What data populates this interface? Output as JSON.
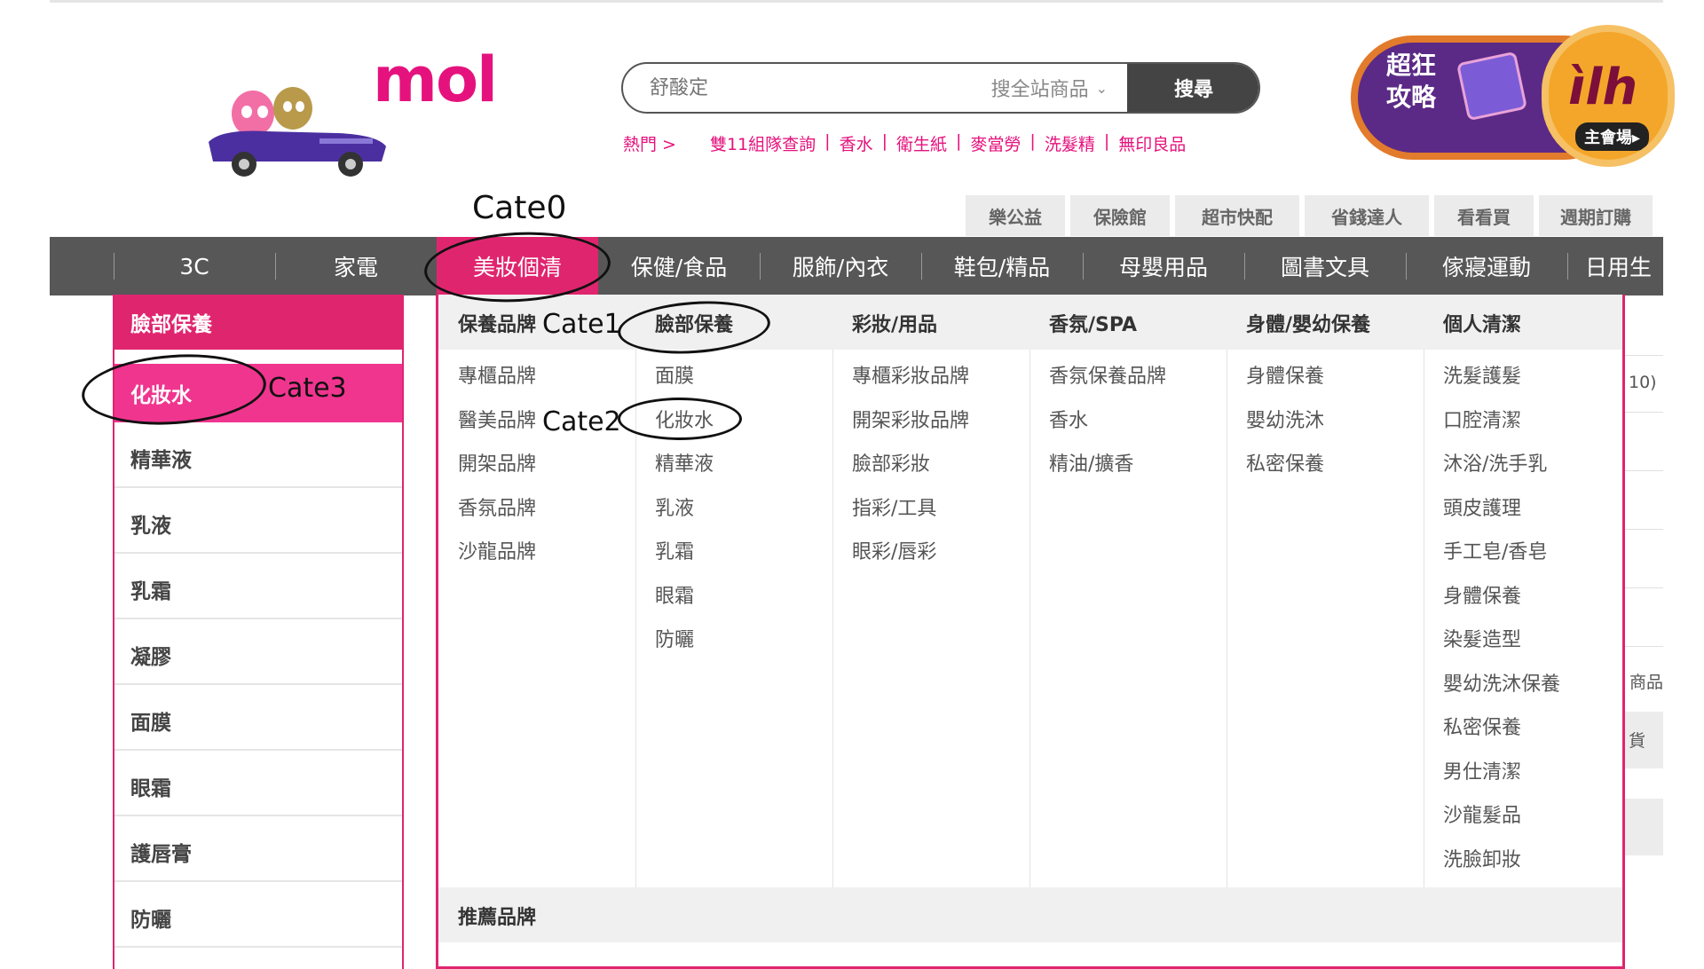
{
  "logo": {
    "text": "mol"
  },
  "search": {
    "placeholder": "舒酸定",
    "scope_label": "搜全站商品",
    "button_label": "搜尋"
  },
  "hot": {
    "label": "熱門 >",
    "keywords": [
      "雙11組隊查詢",
      "香水",
      "衛生紙",
      "麥當勞",
      "洗髮精",
      "無印良品"
    ],
    "separator": "|"
  },
  "promo": {
    "line1": "超狂",
    "line2": "攻略",
    "logo": "ìlh",
    "badge": "主會場▸"
  },
  "top_tabs": [
    "樂公益",
    "保險館",
    "超市快配",
    "省錢達人",
    "看看買",
    "週期訂購"
  ],
  "nav": {
    "items": [
      "3C",
      "家電",
      "美妝個清",
      "保健/食品",
      "服飾/內衣",
      "鞋包/精品",
      "母嬰用品",
      "圖書文具",
      "傢寢運動",
      "日用生"
    ],
    "active": "美妝個清"
  },
  "left_panel": {
    "header": "臉部保養",
    "items": [
      "化妝水",
      "精華液",
      "乳液",
      "乳霜",
      "凝膠",
      "面膜",
      "眼霜",
      "護唇膏",
      "防曬"
    ],
    "active": "化妝水"
  },
  "mega_menu": {
    "columns": [
      {
        "title": "保養品牌",
        "links": [
          "專櫃品牌",
          "醫美品牌",
          "開架品牌",
          "香氛品牌",
          "沙龍品牌"
        ]
      },
      {
        "title": "臉部保養",
        "links": [
          "面膜",
          "化妝水",
          "精華液",
          "乳液",
          "乳霜",
          "眼霜",
          "防曬"
        ]
      },
      {
        "title": "彩妝/用品",
        "links": [
          "專櫃彩妝品牌",
          "開架彩妝品牌",
          "臉部彩妝",
          "指彩/工具",
          "眼彩/唇彩"
        ]
      },
      {
        "title": "香氛/SPA",
        "links": [
          "香氛保養品牌",
          "香水",
          "精油/擴香"
        ]
      },
      {
        "title": "身體/嬰幼保養",
        "links": [
          "身體保養",
          "嬰幼洗沐",
          "私密保養"
        ]
      },
      {
        "title": "個人清潔",
        "links": [
          "洗髮護髮",
          "口腔清潔",
          "沐浴/洗手乳",
          "頭皮護理",
          "手工皂/香皂",
          "身體保養",
          "染髮造型",
          "嬰幼洗沐保養",
          "私密保養",
          "男仕清潔",
          "沙龍髮品",
          "洗臉卸妝"
        ]
      }
    ],
    "recommended_brands": "推薦品牌"
  },
  "annotations": {
    "cate0": "Cate0",
    "cate1": "Cate1",
    "cate2": "Cate2",
    "cate3": "Cate3"
  },
  "right_peek": {
    "text1": "10)",
    "text2": "商品",
    "text3": "貨"
  },
  "colors": {
    "brand": "#e5127d",
    "nav_bg": "#575757",
    "active": "#e0256f"
  }
}
